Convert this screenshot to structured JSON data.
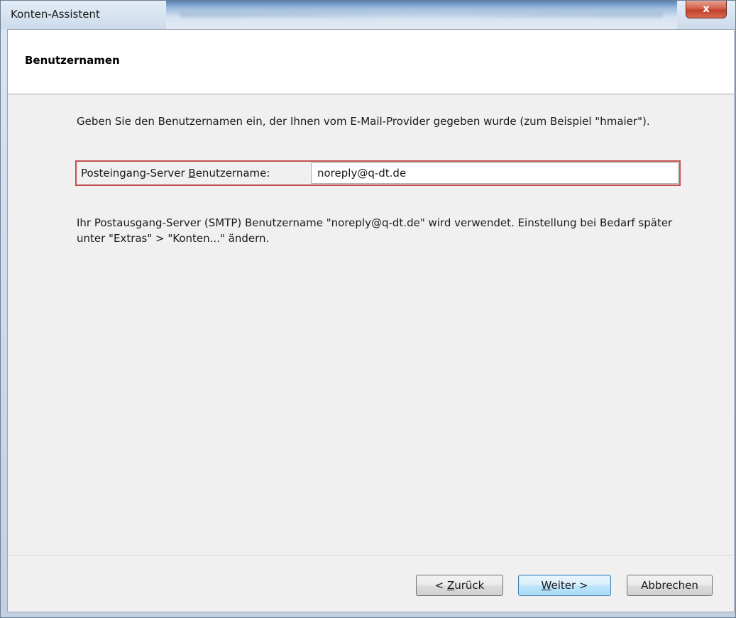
{
  "window": {
    "title": "Konten-Assistent",
    "close_label": "x"
  },
  "header": {
    "title": "Benutzernamen"
  },
  "main": {
    "intro": "Geben Sie den Benutzernamen ein, der Ihnen vom E-Mail-Provider gegeben wurde (zum Beispiel \"hmaier\").",
    "field_label_pre": "Posteingang-Server ",
    "field_label_accel": "B",
    "field_label_post": "enutzername:",
    "field_value": "noreply@q-dt.de",
    "smtp_note": "Ihr Postausgang-Server (SMTP) Benutzername \"noreply@q-dt.de\" wird verwendet. Einstellung bei Bedarf später unter \"Extras\" > \"Konten...\" ändern."
  },
  "footer": {
    "back_pre": "< ",
    "back_accel": "Z",
    "back_post": "urück",
    "next_accel": "W",
    "next_post": "eiter >",
    "cancel_label": "Abbrechen"
  },
  "colors": {
    "highlight_border": "#c0504d",
    "default_button_border": "#3c7fb1"
  }
}
